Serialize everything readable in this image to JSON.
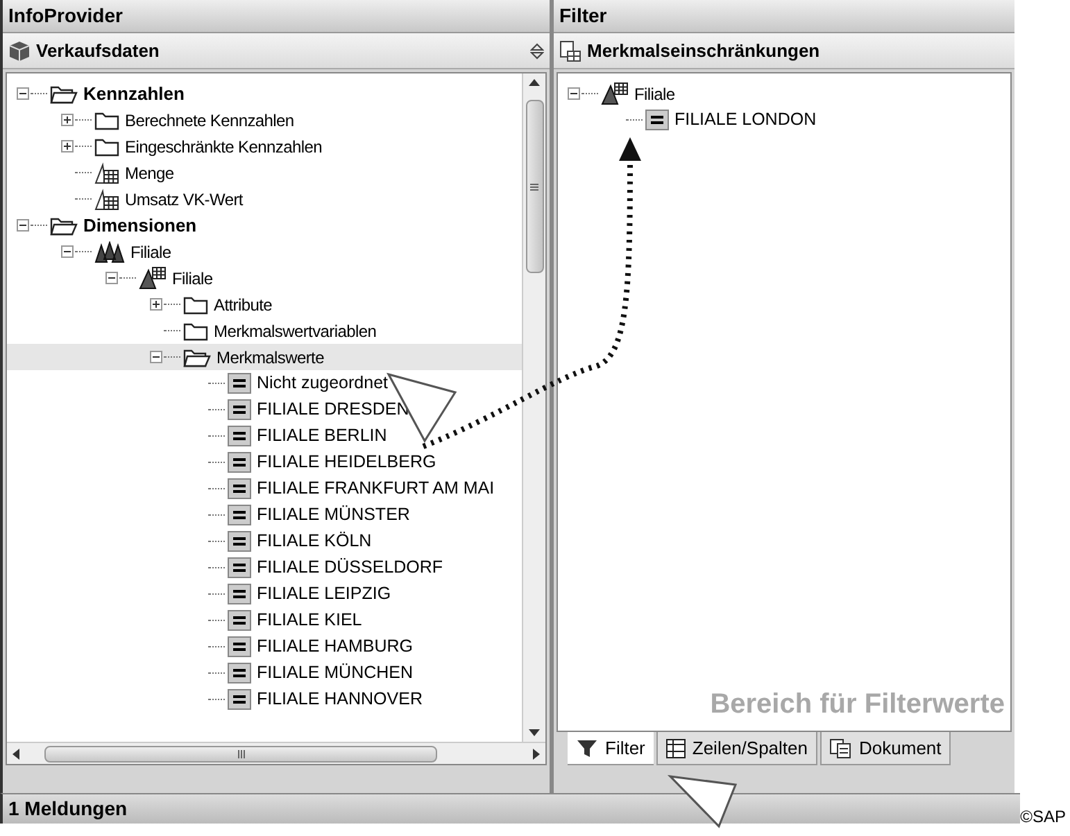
{
  "left_panel": {
    "title": "InfoProvider",
    "provider": "Verkaufsdaten",
    "tree": [
      {
        "label": "Kennzahlen",
        "kind": "folder",
        "expanded": true,
        "selected": false,
        "children": [
          {
            "label": "Berechnete Kennzahlen",
            "kind": "folder",
            "expanded": false,
            "selected": false
          },
          {
            "label": "Eingeschränkte Kennzahlen",
            "kind": "folder",
            "expanded": false,
            "selected": false
          },
          {
            "label": "Menge",
            "kind": "keyfigure",
            "selected": false
          },
          {
            "label": "Umsatz VK-Wert",
            "kind": "keyfigure",
            "selected": false
          }
        ]
      },
      {
        "label": "Dimensionen",
        "kind": "folder",
        "expanded": true,
        "selected": false,
        "children": [
          {
            "label": "Filiale",
            "kind": "dimension",
            "expanded": true,
            "selected": false,
            "children": [
              {
                "label": "Filiale",
                "kind": "characteristic",
                "expanded": true,
                "selected": false,
                "children": [
                  {
                    "label": "Attribute",
                    "kind": "folder",
                    "expanded": false,
                    "selected": false
                  },
                  {
                    "label": "Merkmalswertvariablen",
                    "kind": "folder",
                    "selected": false
                  },
                  {
                    "label": "Merkmalswerte",
                    "kind": "folder",
                    "expanded": true,
                    "selected": true,
                    "children": [
                      {
                        "label": "Nicht zugeordnet",
                        "kind": "value",
                        "selected": false
                      },
                      {
                        "label": "FILIALE DRESDEN",
                        "kind": "value",
                        "selected": false
                      },
                      {
                        "label": "FILIALE BERLIN",
                        "kind": "value",
                        "selected": false
                      },
                      {
                        "label": "FILIALE HEIDELBERG",
                        "kind": "value",
                        "selected": false
                      },
                      {
                        "label": "FILIALE FRANKFURT AM MAI",
                        "kind": "value",
                        "selected": false
                      },
                      {
                        "label": "FILIALE MÜNSTER",
                        "kind": "value",
                        "selected": false
                      },
                      {
                        "label": "FILIALE KÖLN",
                        "kind": "value",
                        "selected": false
                      },
                      {
                        "label": "FILIALE DÜSSELDORF",
                        "kind": "value",
                        "selected": false
                      },
                      {
                        "label": "FILIALE LEIPZIG",
                        "kind": "value",
                        "selected": false
                      },
                      {
                        "label": "FILIALE KIEL",
                        "kind": "value",
                        "selected": false
                      },
                      {
                        "label": "FILIALE HAMBURG",
                        "kind": "value",
                        "selected": false
                      },
                      {
                        "label": "FILIALE MÜNCHEN",
                        "kind": "value",
                        "selected": false
                      },
                      {
                        "label": "FILIALE HANNOVER",
                        "kind": "value",
                        "selected": false
                      }
                    ]
                  }
                ]
              }
            ]
          }
        ]
      }
    ]
  },
  "right_panel": {
    "title": "Filter",
    "section": "Merkmalseinschränkungen",
    "tree": [
      {
        "label": "Filiale",
        "kind": "characteristic",
        "expanded": true,
        "selected": false,
        "children": [
          {
            "label": "FILIALE LONDON",
            "kind": "value",
            "selected": false
          }
        ]
      }
    ],
    "drop_hint": "Bereich für Filterwerte",
    "tabs": [
      {
        "label": "Filter",
        "kind": "filter",
        "selected": true
      },
      {
        "label": "Zeilen/Spalten",
        "kind": "grid",
        "selected": false
      },
      {
        "label": "Dokument",
        "kind": "document",
        "selected": false
      }
    ]
  },
  "status_bar": "1 Meldungen",
  "credit": "©SAP"
}
